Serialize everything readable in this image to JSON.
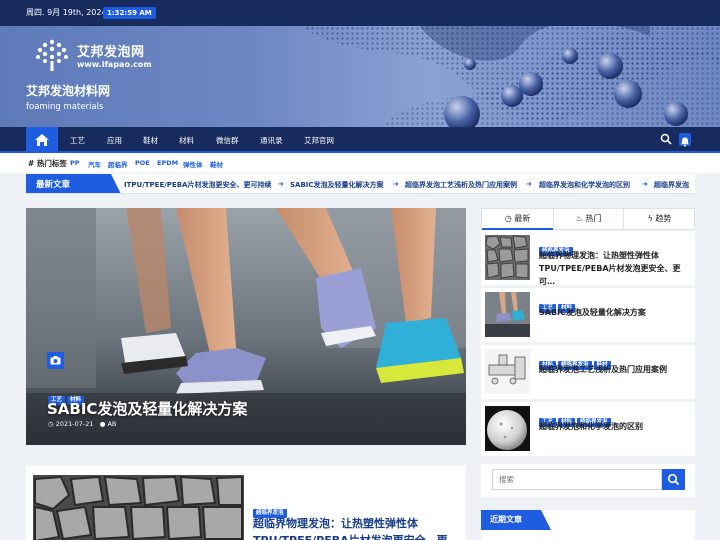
{
  "topbar": {
    "date": "周四. 9月 19th, 2024",
    "time": "1:32:59 AM"
  },
  "logo": {
    "brand": "艾邦发泡网",
    "url": "www.ifapao.com"
  },
  "site": {
    "title": "艾邦发泡材料网",
    "description": "foaming materials"
  },
  "nav": {
    "items": [
      "工艺",
      "应用",
      "鞋材",
      "材料",
      "微信群",
      "通讯录",
      "艾邦官网"
    ],
    "icons": {
      "home": "home-icon",
      "search": "search-icon",
      "bell": "bell-icon"
    }
  },
  "hot_tags": {
    "label": "热门标签",
    "items": [
      "PP",
      "汽车",
      "超临界",
      "POE",
      "EPDM",
      "弹性体",
      "鞋材"
    ]
  },
  "ticker": {
    "label": "最新文章",
    "items": [
      "ITPU/TPEE/PEBA片材发泡更安全、更可持续",
      "SABIC发泡及轻量化解决方案",
      "超临界发泡工艺浅析及热门应用案例",
      "超临界发泡和化学发泡的区别",
      "超临界发泡"
    ]
  },
  "hero": {
    "categories": [
      "工艺",
      "材料"
    ],
    "title": "SABIC发泡及轻量化解决方案",
    "date": "2021-07-21",
    "author": "AB"
  },
  "sidebar": {
    "tabs": [
      {
        "label": "最新",
        "icon": "clock-icon"
      },
      {
        "label": "热门",
        "icon": "fire-icon"
      },
      {
        "label": "趋势",
        "icon": "bolt-icon"
      }
    ],
    "posts": [
      {
        "categories": [
          "超临界发泡"
        ],
        "title": "超临界物理发泡：让热塑性弹性体TPU/TPEE/PEBA片材发泡更安全、更可…"
      },
      {
        "categories": [
          "工艺",
          "材料"
        ],
        "title": "SABIC发泡及轻量化解决方案"
      },
      {
        "categories": [
          "材料",
          "超临界发泡",
          "鞋材"
        ],
        "title": "超临界发泡工艺浅析及热门应用案例"
      },
      {
        "categories": [
          "工艺",
          "材料",
          "超临界发泡"
        ],
        "title": "超临界发泡和化学发泡的区别"
      }
    ]
  },
  "article": {
    "categories": [
      "超临界发泡"
    ],
    "title": "超临界物理发泡：让热塑性弹性体TPU/TPEE/PEBA片材发泡更安全、更可"
  },
  "search": {
    "placeholder": "搜索"
  },
  "recent": {
    "label": "近期文章"
  },
  "colors": {
    "navy": "#172b5e",
    "accent": "#1e5de0"
  }
}
